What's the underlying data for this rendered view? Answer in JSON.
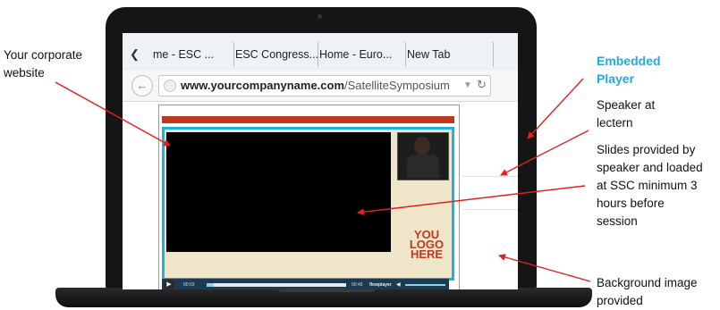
{
  "annotations": {
    "corporate_website": "Your corporate website",
    "embedded_player": "Embedded Player",
    "speaker": "Speaker at lectern",
    "slides": "Slides provided by speaker and loaded at SSC minimum 3 hours before session",
    "background": "Background image provided"
  },
  "browser": {
    "tabs": [
      "me - ESC ...",
      "ESC Congress...",
      "Home - Euro...",
      "New Tab"
    ],
    "url_domain": "www.yourcompanyname.com",
    "url_path": "/SatelliteSymposium"
  },
  "player": {
    "logo_lines": [
      "YOU",
      "LOGO",
      "HERE"
    ],
    "time_elapsed": "00:03",
    "time_total": "00:45",
    "brand": "flowplayer",
    "progress": 0.05
  },
  "colors": {
    "accent_blue": "#2aa6dd",
    "arrow_red": "#e02020",
    "player_border": "#1eb1e8",
    "banner_red": "#c0391f"
  },
  "icons": [
    "back-arrow-icon",
    "globe-icon",
    "refresh-icon",
    "play-icon",
    "volume-icon",
    "tab-scroll-left-icon"
  ]
}
